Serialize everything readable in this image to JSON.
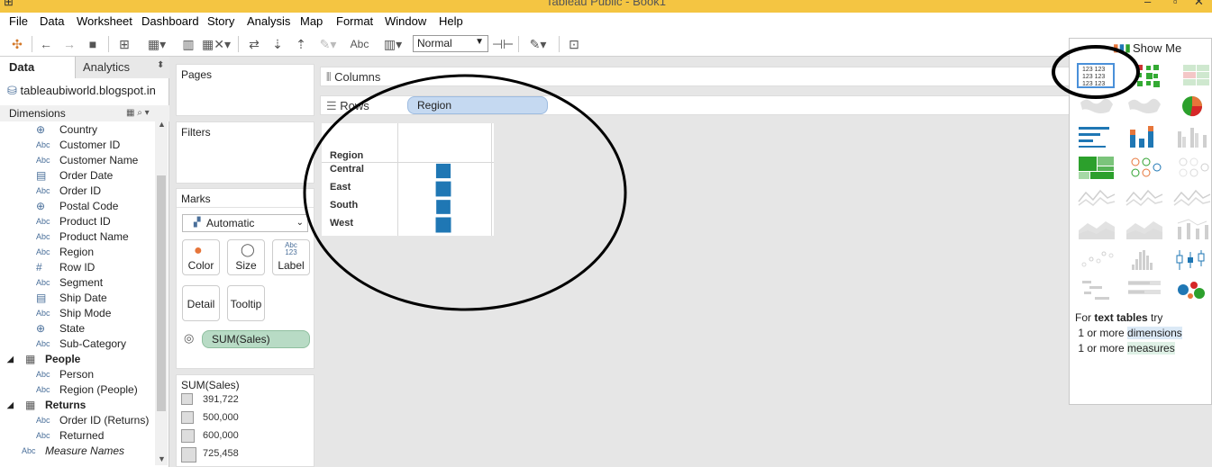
{
  "window": {
    "title": "Tableau Public - Book1"
  },
  "menu": [
    "File",
    "Data",
    "Worksheet",
    "Dashboard",
    "Story",
    "Analysis",
    "Map",
    "Format",
    "Window",
    "Help"
  ],
  "toolbar": {
    "format_value": "Normal"
  },
  "datapane": {
    "tabs": {
      "data": "Data",
      "analytics": "Analytics"
    },
    "datasource": "tableaubiworld.blogspot.in",
    "dimensions_header": "Dimensions",
    "fields": [
      {
        "type": "globe",
        "label": "Country"
      },
      {
        "type": "Abc",
        "label": "Customer ID"
      },
      {
        "type": "Abc",
        "label": "Customer Name"
      },
      {
        "type": "calendar",
        "label": "Order Date"
      },
      {
        "type": "Abc",
        "label": "Order ID"
      },
      {
        "type": "globe",
        "label": "Postal Code"
      },
      {
        "type": "Abc",
        "label": "Product ID"
      },
      {
        "type": "Abc",
        "label": "Product Name"
      },
      {
        "type": "Abc",
        "label": "Region"
      },
      {
        "type": "#",
        "label": "Row ID"
      },
      {
        "type": "Abc",
        "label": "Segment"
      },
      {
        "type": "calendar",
        "label": "Ship Date"
      },
      {
        "type": "Abc",
        "label": "Ship Mode"
      },
      {
        "type": "globe",
        "label": "State"
      },
      {
        "type": "Abc",
        "label": "Sub-Category"
      }
    ],
    "groups": [
      {
        "name": "People",
        "fields": [
          "Person",
          "Region (People)"
        ]
      },
      {
        "name": "Returns",
        "fields": [
          "Order ID (Returns)",
          "Returned"
        ]
      }
    ],
    "measure_names": "Measure Names"
  },
  "cards": {
    "pages": "Pages",
    "filters": "Filters",
    "marks": "Marks",
    "marks_type": "Automatic",
    "buttons": {
      "color": "Color",
      "size": "Size",
      "label": "Label",
      "detail": "Detail",
      "tooltip": "Tooltip"
    },
    "label_icon_text": "Abc\n123",
    "sum_pill": "SUM(Sales)"
  },
  "legend": {
    "title": "SUM(Sales)",
    "items": [
      "391,722",
      "500,000",
      "600,000",
      "725,458"
    ]
  },
  "shelves": {
    "columns": "Columns",
    "rows": "Rows",
    "rows_pill": "Region"
  },
  "view": {
    "header": "Region",
    "rows": [
      "Central",
      "East",
      "South",
      "West"
    ]
  },
  "chart_data": {
    "type": "table",
    "categories": [
      "Central",
      "East",
      "South",
      "West"
    ],
    "values": [
      501240,
      678781,
      391722,
      725458
    ],
    "title": "",
    "xlabel": "",
    "ylabel": "Region",
    "encoding": "size"
  },
  "showme": {
    "title": "Show Me",
    "hint": {
      "prefix": "For",
      "bold": "text tables",
      "suffix": "try",
      "line1_pre": "1 or more",
      "line1_hl": "dimensions",
      "line2_pre": "1 or more",
      "line2_hl": "measures"
    }
  },
  "colors": {
    "accent": "#1f77b4",
    "pill_dim": "#c5d9f1",
    "pill_mea": "#b8dbc5",
    "titlebar": "#f4c542"
  }
}
